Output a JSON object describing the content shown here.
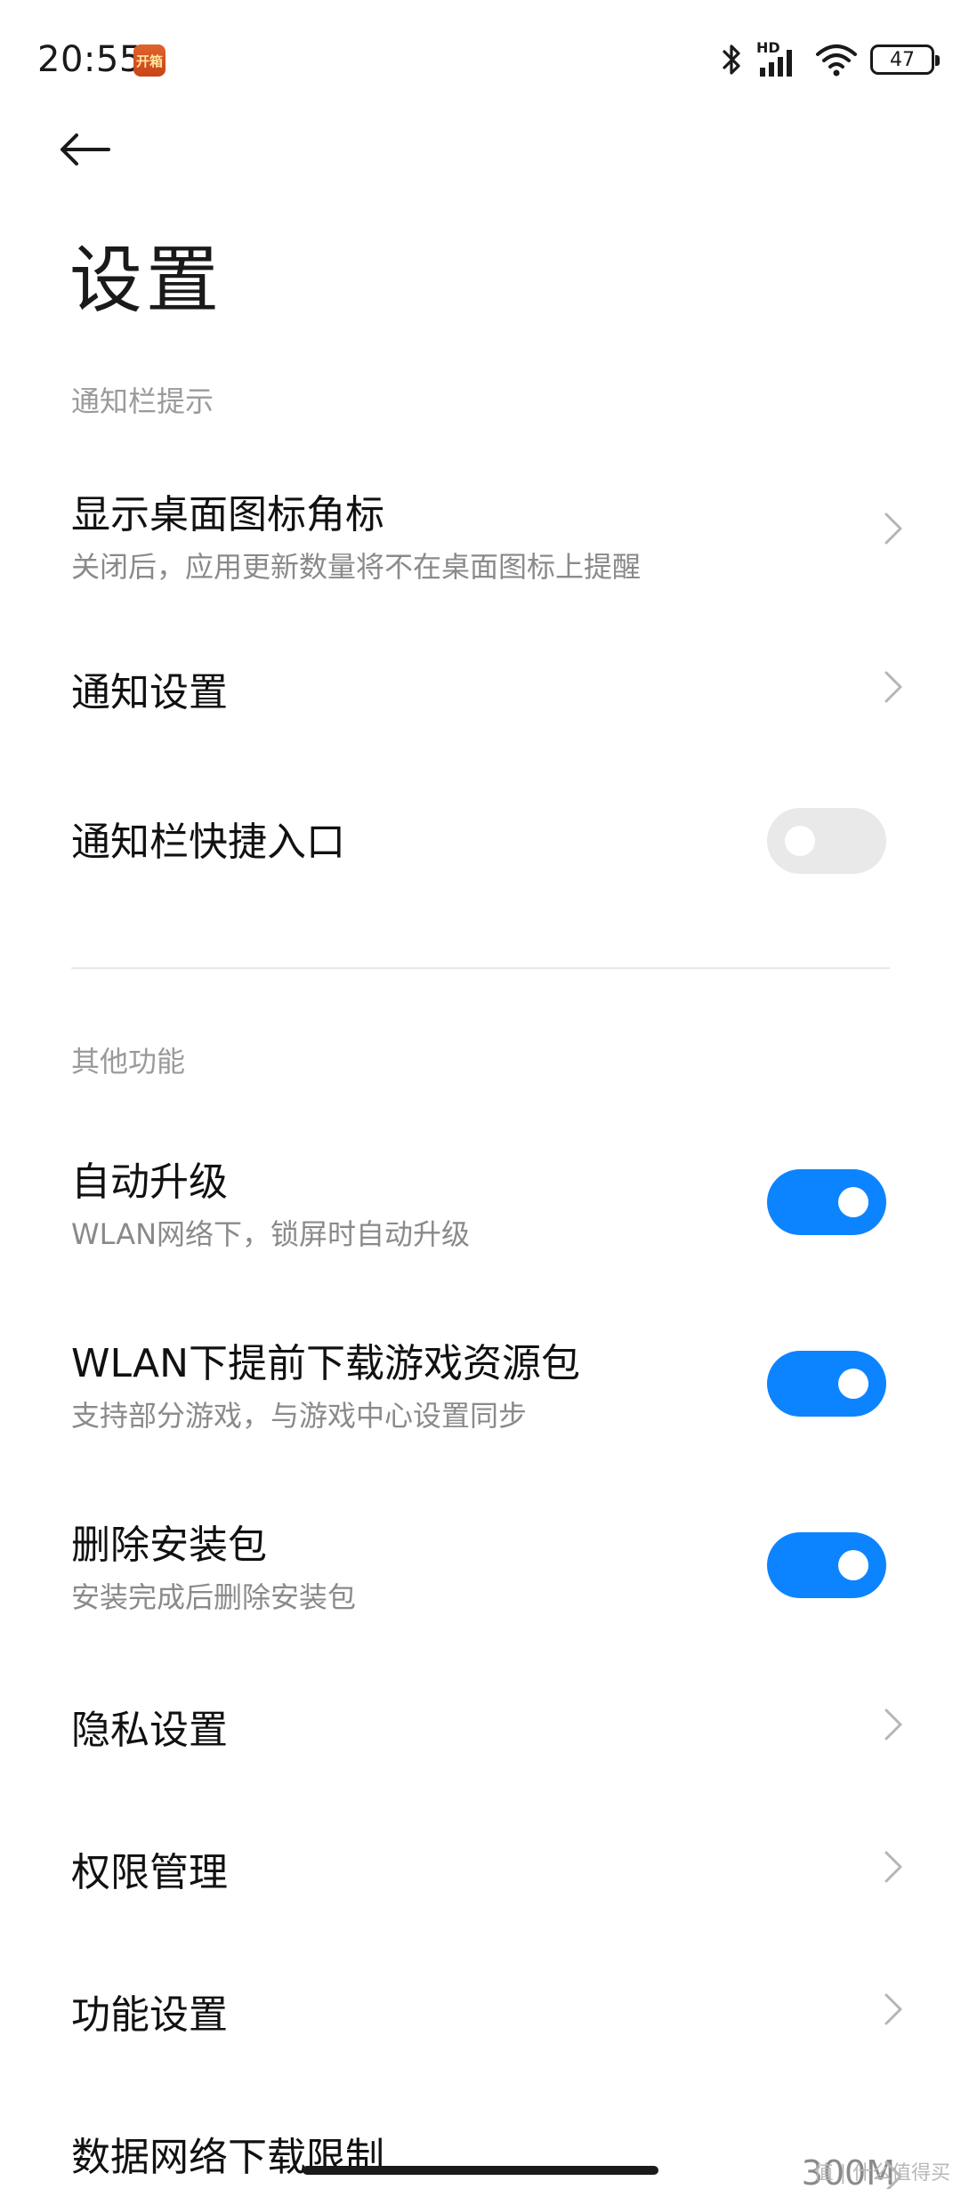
{
  "status_bar": {
    "time": "20:55",
    "app_badge_text": "开箱",
    "network_label": "HD",
    "battery_level": "47"
  },
  "header": {
    "back_icon": "arrow-left-icon",
    "title": "设置"
  },
  "sections": [
    {
      "header": "通知栏提示",
      "items": [
        {
          "title": "显示桌面图标角标",
          "subtitle": "关闭后，应用更新数量将不在桌面图标上提醒",
          "control": "chevron"
        },
        {
          "title": "通知设置",
          "control": "chevron"
        },
        {
          "title": "通知栏快捷入口",
          "control": "toggle",
          "enabled": false
        }
      ]
    },
    {
      "header": "其他功能",
      "items": [
        {
          "title": "自动升级",
          "subtitle": "WLAN网络下，锁屏时自动升级",
          "control": "toggle",
          "enabled": true
        },
        {
          "title": "WLAN下提前下载游戏资源包",
          "subtitle": "支持部分游戏，与游戏中心设置同步",
          "control": "toggle",
          "enabled": true
        },
        {
          "title": "删除安装包",
          "subtitle": "安装完成后删除安装包",
          "control": "toggle",
          "enabled": true
        },
        {
          "title": "隐私设置",
          "control": "chevron"
        },
        {
          "title": "权限管理",
          "control": "chevron"
        },
        {
          "title": "功能设置",
          "control": "chevron"
        },
        {
          "title": "数据网络下载限制",
          "value": "300M",
          "control": "chevron"
        }
      ]
    }
  ],
  "watermark": "值 | 什么值得买",
  "colors": {
    "accent": "#0d84ff",
    "toggle_off": "#e9e9e9",
    "secondary_text": "#8a8a8a",
    "section_header": "#9a9a9a"
  }
}
